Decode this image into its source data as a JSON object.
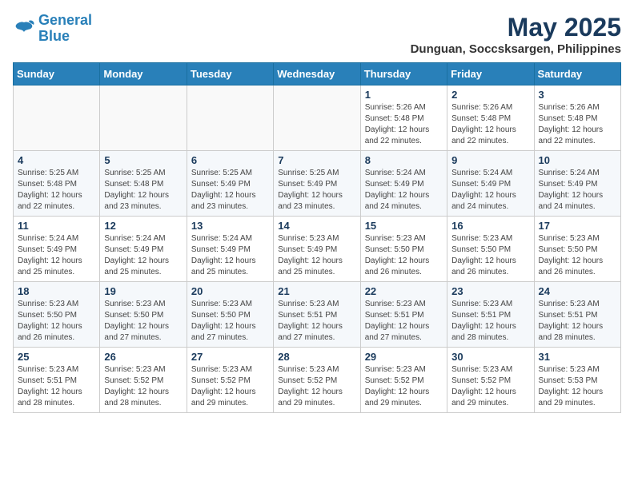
{
  "logo": {
    "line1": "General",
    "line2": "Blue"
  },
  "title": "May 2025",
  "location": "Dunguan, Soccsksargen, Philippines",
  "weekdays": [
    "Sunday",
    "Monday",
    "Tuesday",
    "Wednesday",
    "Thursday",
    "Friday",
    "Saturday"
  ],
  "weeks": [
    [
      {
        "day": "",
        "info": ""
      },
      {
        "day": "",
        "info": ""
      },
      {
        "day": "",
        "info": ""
      },
      {
        "day": "",
        "info": ""
      },
      {
        "day": "1",
        "info": "Sunrise: 5:26 AM\nSunset: 5:48 PM\nDaylight: 12 hours and 22 minutes."
      },
      {
        "day": "2",
        "info": "Sunrise: 5:26 AM\nSunset: 5:48 PM\nDaylight: 12 hours and 22 minutes."
      },
      {
        "day": "3",
        "info": "Sunrise: 5:26 AM\nSunset: 5:48 PM\nDaylight: 12 hours and 22 minutes."
      }
    ],
    [
      {
        "day": "4",
        "info": "Sunrise: 5:25 AM\nSunset: 5:48 PM\nDaylight: 12 hours and 22 minutes."
      },
      {
        "day": "5",
        "info": "Sunrise: 5:25 AM\nSunset: 5:48 PM\nDaylight: 12 hours and 23 minutes."
      },
      {
        "day": "6",
        "info": "Sunrise: 5:25 AM\nSunset: 5:49 PM\nDaylight: 12 hours and 23 minutes."
      },
      {
        "day": "7",
        "info": "Sunrise: 5:25 AM\nSunset: 5:49 PM\nDaylight: 12 hours and 23 minutes."
      },
      {
        "day": "8",
        "info": "Sunrise: 5:24 AM\nSunset: 5:49 PM\nDaylight: 12 hours and 24 minutes."
      },
      {
        "day": "9",
        "info": "Sunrise: 5:24 AM\nSunset: 5:49 PM\nDaylight: 12 hours and 24 minutes."
      },
      {
        "day": "10",
        "info": "Sunrise: 5:24 AM\nSunset: 5:49 PM\nDaylight: 12 hours and 24 minutes."
      }
    ],
    [
      {
        "day": "11",
        "info": "Sunrise: 5:24 AM\nSunset: 5:49 PM\nDaylight: 12 hours and 25 minutes."
      },
      {
        "day": "12",
        "info": "Sunrise: 5:24 AM\nSunset: 5:49 PM\nDaylight: 12 hours and 25 minutes."
      },
      {
        "day": "13",
        "info": "Sunrise: 5:24 AM\nSunset: 5:49 PM\nDaylight: 12 hours and 25 minutes."
      },
      {
        "day": "14",
        "info": "Sunrise: 5:23 AM\nSunset: 5:49 PM\nDaylight: 12 hours and 25 minutes."
      },
      {
        "day": "15",
        "info": "Sunrise: 5:23 AM\nSunset: 5:50 PM\nDaylight: 12 hours and 26 minutes."
      },
      {
        "day": "16",
        "info": "Sunrise: 5:23 AM\nSunset: 5:50 PM\nDaylight: 12 hours and 26 minutes."
      },
      {
        "day": "17",
        "info": "Sunrise: 5:23 AM\nSunset: 5:50 PM\nDaylight: 12 hours and 26 minutes."
      }
    ],
    [
      {
        "day": "18",
        "info": "Sunrise: 5:23 AM\nSunset: 5:50 PM\nDaylight: 12 hours and 26 minutes."
      },
      {
        "day": "19",
        "info": "Sunrise: 5:23 AM\nSunset: 5:50 PM\nDaylight: 12 hours and 27 minutes."
      },
      {
        "day": "20",
        "info": "Sunrise: 5:23 AM\nSunset: 5:50 PM\nDaylight: 12 hours and 27 minutes."
      },
      {
        "day": "21",
        "info": "Sunrise: 5:23 AM\nSunset: 5:51 PM\nDaylight: 12 hours and 27 minutes."
      },
      {
        "day": "22",
        "info": "Sunrise: 5:23 AM\nSunset: 5:51 PM\nDaylight: 12 hours and 27 minutes."
      },
      {
        "day": "23",
        "info": "Sunrise: 5:23 AM\nSunset: 5:51 PM\nDaylight: 12 hours and 28 minutes."
      },
      {
        "day": "24",
        "info": "Sunrise: 5:23 AM\nSunset: 5:51 PM\nDaylight: 12 hours and 28 minutes."
      }
    ],
    [
      {
        "day": "25",
        "info": "Sunrise: 5:23 AM\nSunset: 5:51 PM\nDaylight: 12 hours and 28 minutes."
      },
      {
        "day": "26",
        "info": "Sunrise: 5:23 AM\nSunset: 5:52 PM\nDaylight: 12 hours and 28 minutes."
      },
      {
        "day": "27",
        "info": "Sunrise: 5:23 AM\nSunset: 5:52 PM\nDaylight: 12 hours and 29 minutes."
      },
      {
        "day": "28",
        "info": "Sunrise: 5:23 AM\nSunset: 5:52 PM\nDaylight: 12 hours and 29 minutes."
      },
      {
        "day": "29",
        "info": "Sunrise: 5:23 AM\nSunset: 5:52 PM\nDaylight: 12 hours and 29 minutes."
      },
      {
        "day": "30",
        "info": "Sunrise: 5:23 AM\nSunset: 5:52 PM\nDaylight: 12 hours and 29 minutes."
      },
      {
        "day": "31",
        "info": "Sunrise: 5:23 AM\nSunset: 5:53 PM\nDaylight: 12 hours and 29 minutes."
      }
    ]
  ]
}
